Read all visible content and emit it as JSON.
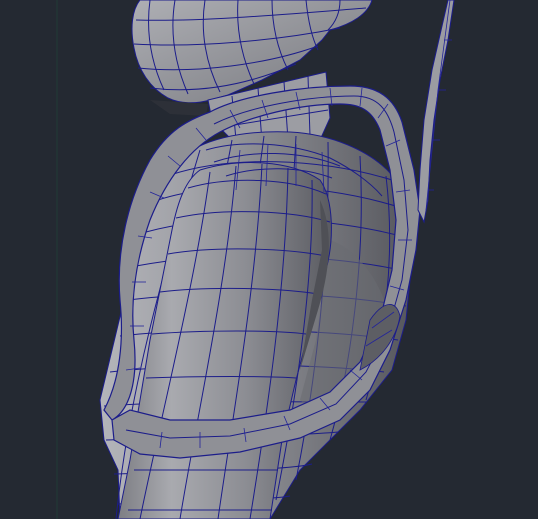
{
  "viewport": {
    "background": "#242932",
    "mesh_fill": "#8f9096",
    "mesh_shadow": "#5b5c62",
    "wire_color": "#1c1d8a",
    "grid_line_color": "#1f6b4a"
  }
}
